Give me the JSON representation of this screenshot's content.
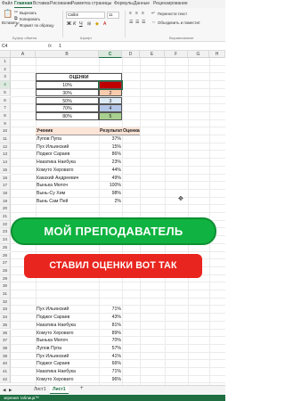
{
  "ribbon_tabs": [
    "Файл",
    "Главная",
    "Вставка",
    "Рисование",
    "Разметка страницы",
    "Формулы",
    "Данные",
    "Рецензирование"
  ],
  "ribbon": {
    "cut_label": "Вырезать",
    "copy_label": "Копировать",
    "format_painter_label": "Формат по образцу",
    "paste_label": "Вставить",
    "clipboard_group": "Буфер обмена",
    "font_name": "Calibri",
    "font_size": "11",
    "font_group": "Шрифт",
    "wrap_text_label": "Перенести текст",
    "merge_label": "Объединить и поместит",
    "alignment_group": "Выравнивание",
    "bold": "Ж",
    "italic": "К",
    "underline": "Ч"
  },
  "formula_bar": {
    "name_box": "C4",
    "fx": "fx",
    "value": "1"
  },
  "columns": [
    "A",
    "B",
    "C",
    "D",
    "E",
    "F",
    "G",
    "H"
  ],
  "rows": [
    "1",
    "2",
    "3",
    "4",
    "5",
    "6",
    "7",
    "8",
    "9",
    "10",
    "11",
    "12",
    "13",
    "14",
    "15",
    "16",
    "17",
    "18",
    "19",
    "20",
    "21",
    "22",
    "23",
    "24",
    "25",
    "26",
    "27",
    "28",
    "29",
    "30",
    "31",
    "32",
    "33",
    "34",
    "35",
    "36",
    "37",
    "38",
    "39",
    "40",
    "41",
    "42"
  ],
  "grades_table": {
    "header": "ОЦЕНКИ",
    "rows": [
      {
        "pct": "10%",
        "grade": "",
        "color": "#c00000"
      },
      {
        "pct": "30%",
        "grade": "2",
        "color": "#f8cbad"
      },
      {
        "pct": "50%",
        "grade": "3",
        "color": "#ddebf7"
      },
      {
        "pct": "70%",
        "grade": "4",
        "color": "#b4c6e7"
      },
      {
        "pct": "80%",
        "grade": "5",
        "color": "#a9d08e"
      }
    ]
  },
  "students_table": {
    "headers": [
      "Ученик",
      "Результат",
      "Оценка"
    ],
    "rows_top": [
      [
        "Лупов Пупа",
        "37%"
      ],
      [
        "Пух Ильинский",
        "15%"
      ],
      [
        "Поджог Сараев",
        "86%"
      ],
      [
        "Накатика Наебука",
        "23%"
      ],
      [
        "Комуто Херовато",
        "44%"
      ],
      [
        "Какахий Андреевич",
        "49%"
      ],
      [
        "Вынька Мелоч",
        "100%"
      ],
      [
        "Вынь-Су Хим",
        "98%"
      ],
      [
        "Вынь Сам Пей",
        "2%"
      ]
    ],
    "rows_bottom": [
      [
        "Пух Ильинский",
        "71%"
      ],
      [
        "Поджог Сараев",
        "43%"
      ],
      [
        "Накатика Наебука",
        "81%"
      ],
      [
        "Комуто Херовато",
        "89%"
      ],
      [
        "Вынька Мелоч",
        "70%"
      ],
      [
        "Лупов Пупа",
        "57%"
      ],
      [
        "Пух Ильинский",
        "41%"
      ],
      [
        "Поджог Сараев",
        "66%"
      ],
      [
        "Накатика Наебука",
        "71%"
      ],
      [
        "Комуто Херовато",
        "96%"
      ]
    ]
  },
  "banners": {
    "top": "МОЙ ПРЕПОДАВАТЕЛЬ",
    "bottom": "СТАВИЛ ОЦЕНКИ ВОТ ТАК"
  },
  "sheet_tabs": [
    "Лист1",
    "Лист1"
  ],
  "add_sheet": "+",
  "status_text": "зерения таблица™"
}
